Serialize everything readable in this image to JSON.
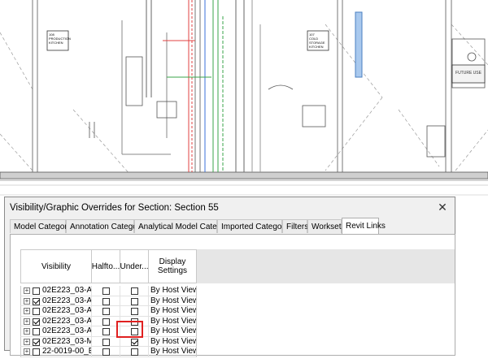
{
  "view": {
    "tags": [
      {
        "number": "108",
        "line1": "PRODUCTION",
        "line2": "KITCHEN"
      },
      {
        "number": "107",
        "line1": "COLD",
        "line2": "STORAGE",
        "line3": "KITCHEN"
      }
    ],
    "stamp": "FUTURE USE"
  },
  "dialog": {
    "title": "Visibility/Graphic Overrides for Section: Section 55",
    "close_glyph": "✕",
    "tabs": [
      {
        "label": "Model Categories"
      },
      {
        "label": "Annotation Categories"
      },
      {
        "label": "Analytical Model Categories"
      },
      {
        "label": "Imported Categories"
      },
      {
        "label": "Filters"
      },
      {
        "label": "Worksets"
      },
      {
        "label": "Revit Links",
        "active": true
      }
    ],
    "columns": {
      "visibility": "Visibility",
      "halftone": "Halfto...",
      "underlay": "Under...",
      "display_settings_1": "Display",
      "display_settings_2": "Settings"
    },
    "rows": [
      {
        "name": "02E223_03-A-...",
        "visible": false,
        "halftone": false,
        "underlay": false,
        "display": "By Host View"
      },
      {
        "name": "02E223_03-A-...",
        "visible": true,
        "halftone": false,
        "underlay": false,
        "display": "By Host View"
      },
      {
        "name": "02E223_03-A-...",
        "visible": false,
        "halftone": false,
        "underlay": false,
        "display": "By Host View"
      },
      {
        "name": "02E223_03-A-...",
        "visible": true,
        "halftone": false,
        "underlay": false,
        "display": "By Host View"
      },
      {
        "name": "02E223_03-A-...",
        "visible": false,
        "halftone": false,
        "underlay": false,
        "display": "By Host View"
      },
      {
        "name": "02E223_03-M...",
        "visible": true,
        "halftone": false,
        "underlay": true,
        "display": "By Host View"
      },
      {
        "name": "22-0019-00_E...",
        "visible": false,
        "halftone": false,
        "underlay": false,
        "display": "By Host View"
      }
    ],
    "expander_glyph": "+"
  },
  "colors": {
    "highlight": "#e02020",
    "selection": "#0a64d2",
    "pipe_red": "#e04040",
    "pipe_green": "#3aa64a",
    "pipe_blue": "#3b6fd8"
  }
}
